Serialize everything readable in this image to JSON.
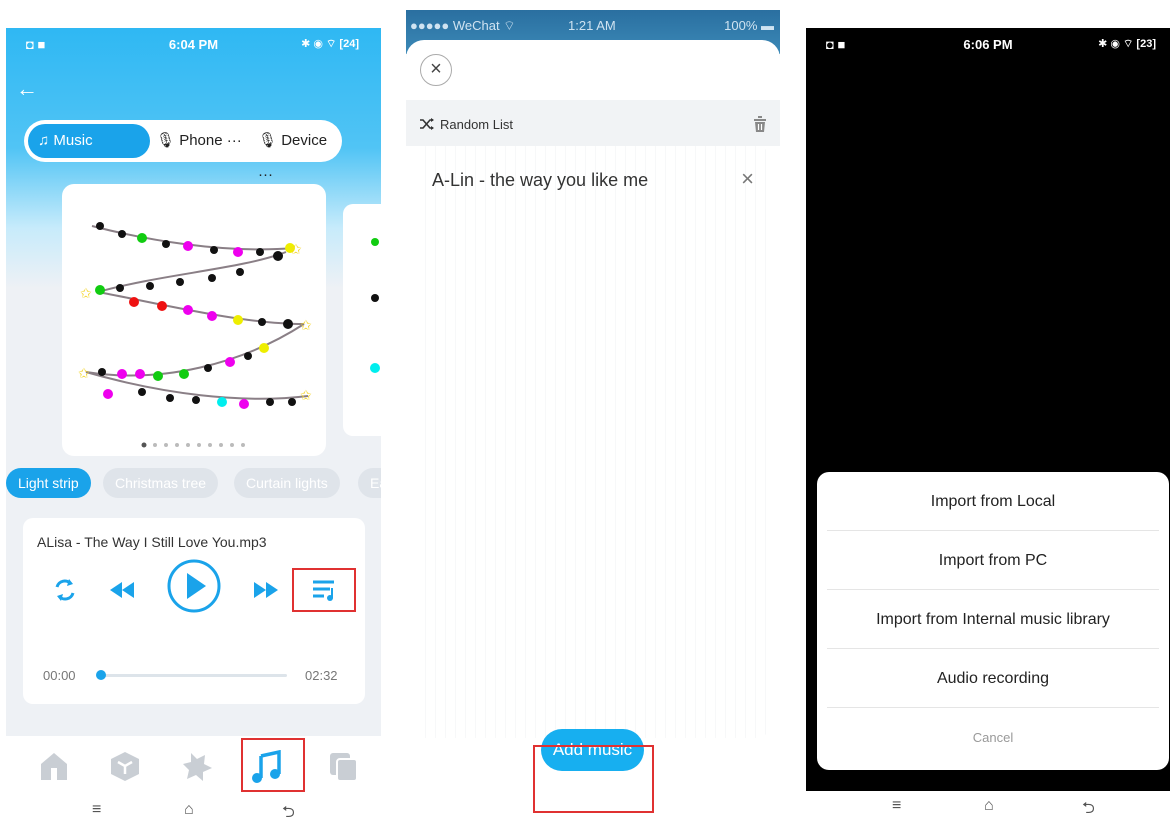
{
  "panel1": {
    "status": {
      "left": "◘ ■",
      "time": "6:04 PM",
      "right": "✱ ◉ ⌔ [24]"
    },
    "back_icon": "←",
    "tabs": [
      {
        "label": "♫ Music",
        "icon": "music-note-icon"
      },
      {
        "label": "🎙 Phone ···",
        "icon": "microphone-icon"
      },
      {
        "label": "🎙 Device ···",
        "icon": "microphone-icon"
      }
    ],
    "scenes": [
      "Light strip",
      "Christmas tree",
      "Curtain lights",
      "Ea"
    ],
    "player": {
      "song": "ALisa - The Way I Still Love You.mp3",
      "current_time": "00:00",
      "total_time": "02:32",
      "progress": 0.02
    },
    "accent_color": "#1aa3ea",
    "highlight_color": "#e03131"
  },
  "panel2": {
    "status": {
      "carrier": "●●●●● WeChat ⌔",
      "time": "1:21 AM",
      "battery": "100% ▬"
    },
    "close_icon": "×",
    "list_title": "Random List",
    "songs": [
      "A-Lin - the way you like me"
    ],
    "remove_icon": "×",
    "add_button": "Add music"
  },
  "panel3": {
    "status": {
      "left": "◘ ■",
      "time": "6:06 PM",
      "right": "✱ ◉ ⌔ [23]"
    },
    "options": [
      "Import from Local",
      "Import from PC",
      "Import from Internal music library",
      "Audio recording"
    ],
    "cancel": "Cancel"
  },
  "nav_icons": {
    "menu": "≡",
    "home": "⌂",
    "back": "⮌"
  }
}
